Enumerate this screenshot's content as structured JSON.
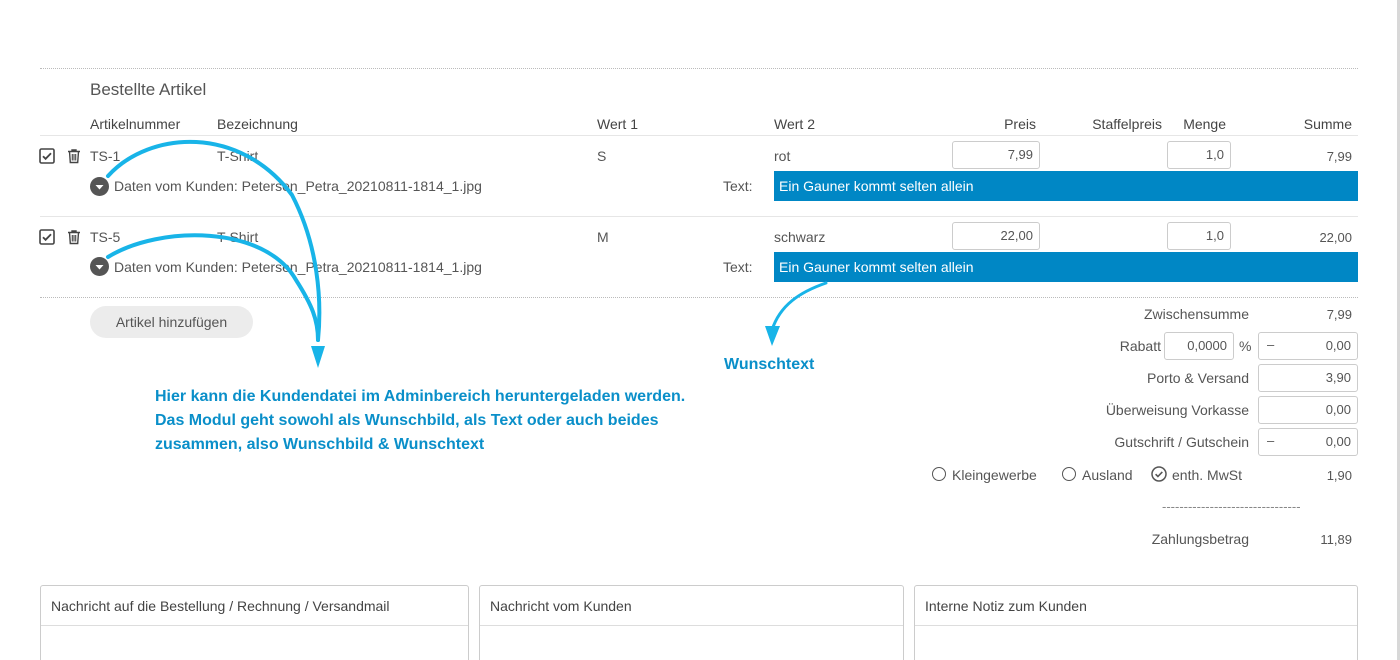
{
  "section_title": "Bestellte Artikel",
  "columns": {
    "artikelnummer": "Artikelnummer",
    "bezeichnung": "Bezeichnung",
    "wert1": "Wert 1",
    "wert2": "Wert 2",
    "preis": "Preis",
    "staffelpreis": "Staffelpreis",
    "menge": "Menge",
    "summe": "Summe"
  },
  "rows": [
    {
      "artikelnummer": "TS-1",
      "bezeichnung": "T-Shirt",
      "wert1": "S",
      "wert2": "rot",
      "preis": "7,99",
      "menge": "1,0",
      "summe": "7,99",
      "kundendatei": "Daten vom Kunden: Petersen_Petra_20210811-1814_1.jpg",
      "text_label": "Text:",
      "text_value": "Ein Gauner kommt selten allein"
    },
    {
      "artikelnummer": "TS-5",
      "bezeichnung": "T-Shirt",
      "wert1": "M",
      "wert2": "schwarz",
      "preis": "22,00",
      "menge": "1,0",
      "summe": "22,00",
      "kundendatei": "Daten vom Kunden: Petersen_Petra_20210811-1814_1.jpg",
      "text_label": "Text:",
      "text_value": "Ein Gauner kommt selten allein"
    }
  ],
  "add_button": "Artikel hinzufügen",
  "totals": {
    "zwischensumme_label": "Zwischensumme",
    "zwischensumme_value": "7,99",
    "rabatt_label": "Rabatt",
    "rabatt_percent": "0,0000",
    "percent_sign": "%",
    "minus_sign": "–",
    "rabatt_value": "0,00",
    "porto_label": "Porto & Versand",
    "porto_value": "3,90",
    "ueberweisung_label": "Überweisung Vorkasse",
    "ueberweisung_value": "0,00",
    "gutschrift_label": "Gutschrift / Gutschein",
    "gutschrift_value": "0,00",
    "kleingewerbe_label": "Kleingewerbe",
    "ausland_label": "Ausland",
    "mwst_label": "enth. MwSt",
    "mwst_value": "1,90",
    "dashes": "--------------------------------",
    "zahlungsbetrag_label": "Zahlungsbetrag",
    "zahlungsbetrag_value": "11,89"
  },
  "annotations": {
    "wunschtext": "Wunschtext",
    "hint_line1": "Hier kann die Kundendatei im Adminbereich heruntergeladen werden.",
    "hint_line2": "Das Modul geht sowohl als Wunschbild, als Text oder auch beides",
    "hint_line3": "zusammen, also Wunschbild & Wunschtext"
  },
  "message_boxes": [
    "Nachricht auf die Bestellung / Rechnung / Versandmail",
    "Nachricht vom Kunden",
    "Interne Notiz zum Kunden"
  ],
  "colors": {
    "accent": "#0087c5",
    "annotation": "#0a8fc9"
  }
}
